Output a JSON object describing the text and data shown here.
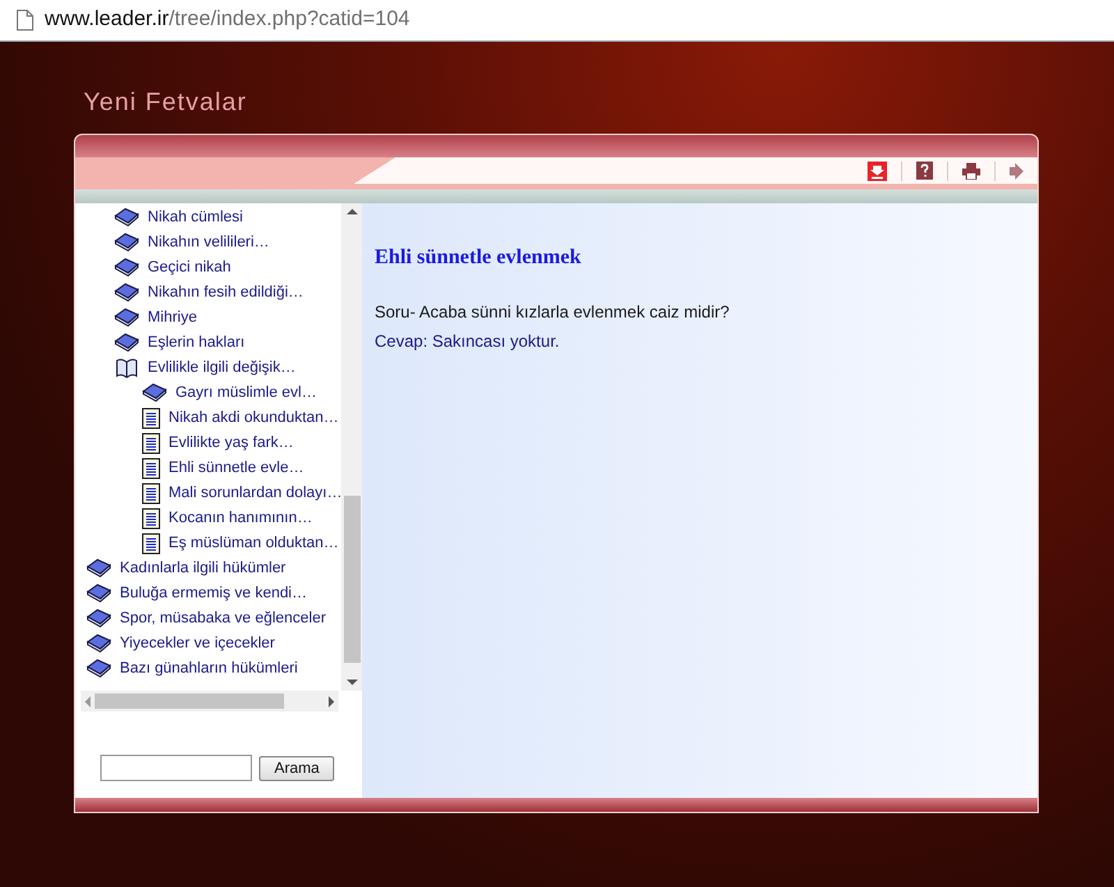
{
  "address_bar": {
    "host": "www.leader.ir",
    "path": "/tree/index.php?catid=104"
  },
  "page_title": "Yeni Fetvalar",
  "toolbar": [
    {
      "kind": "download"
    },
    {
      "kind": "help"
    },
    {
      "kind": "print"
    },
    {
      "kind": "forward"
    }
  ],
  "tree": {
    "items": [
      {
        "children": [
          {
            "kind": "book",
            "label": "Nikah cümlesi"
          },
          {
            "kind": "book",
            "label": "Nikahın velilileri…"
          },
          {
            "kind": "book",
            "label": "Geçici nikah"
          },
          {
            "kind": "book",
            "label": "Nikahın fesih edildiği…"
          },
          {
            "kind": "book",
            "label": "Mihriye"
          },
          {
            "kind": "book",
            "label": "Eşlerin hakları"
          },
          {
            "kind": "open-book",
            "label": "Evlilikle ilgili değişik…",
            "children": [
              {
                "kind": "book",
                "label": "Gayrı müslimle evl…"
              },
              {
                "kind": "page",
                "label": "Nikah akdi okunduktan…"
              },
              {
                "kind": "page",
                "label": "Evlilikte yaş fark…"
              },
              {
                "kind": "page",
                "label": "Ehli sünnetle evle…"
              },
              {
                "kind": "page",
                "label": "Mali sorunlardan dolayı…"
              },
              {
                "kind": "page",
                "label": "Kocanın hanımının…"
              },
              {
                "kind": "page",
                "label": "Eş müslüman olduktan…"
              }
            ]
          }
        ]
      },
      {
        "kind": "book",
        "label": "Kadınlarla ilgili hükümler"
      },
      {
        "kind": "book",
        "label": "Buluğa ermemiş ve kendi…"
      },
      {
        "kind": "book",
        "label": "Spor, müsabaka ve eğlenceler"
      },
      {
        "kind": "book",
        "label": "Yiyecekler ve içecekler"
      },
      {
        "kind": "book",
        "label": "Bazı günahların hükümleri"
      }
    ]
  },
  "search": {
    "button": "Arama"
  },
  "article": {
    "title": "Ehli sünnetle evlenmek",
    "question": "Soru- Acaba sünni kızlarla evlenmek caiz midir?",
    "answer": "Cevap: Sakıncası yoktur."
  }
}
